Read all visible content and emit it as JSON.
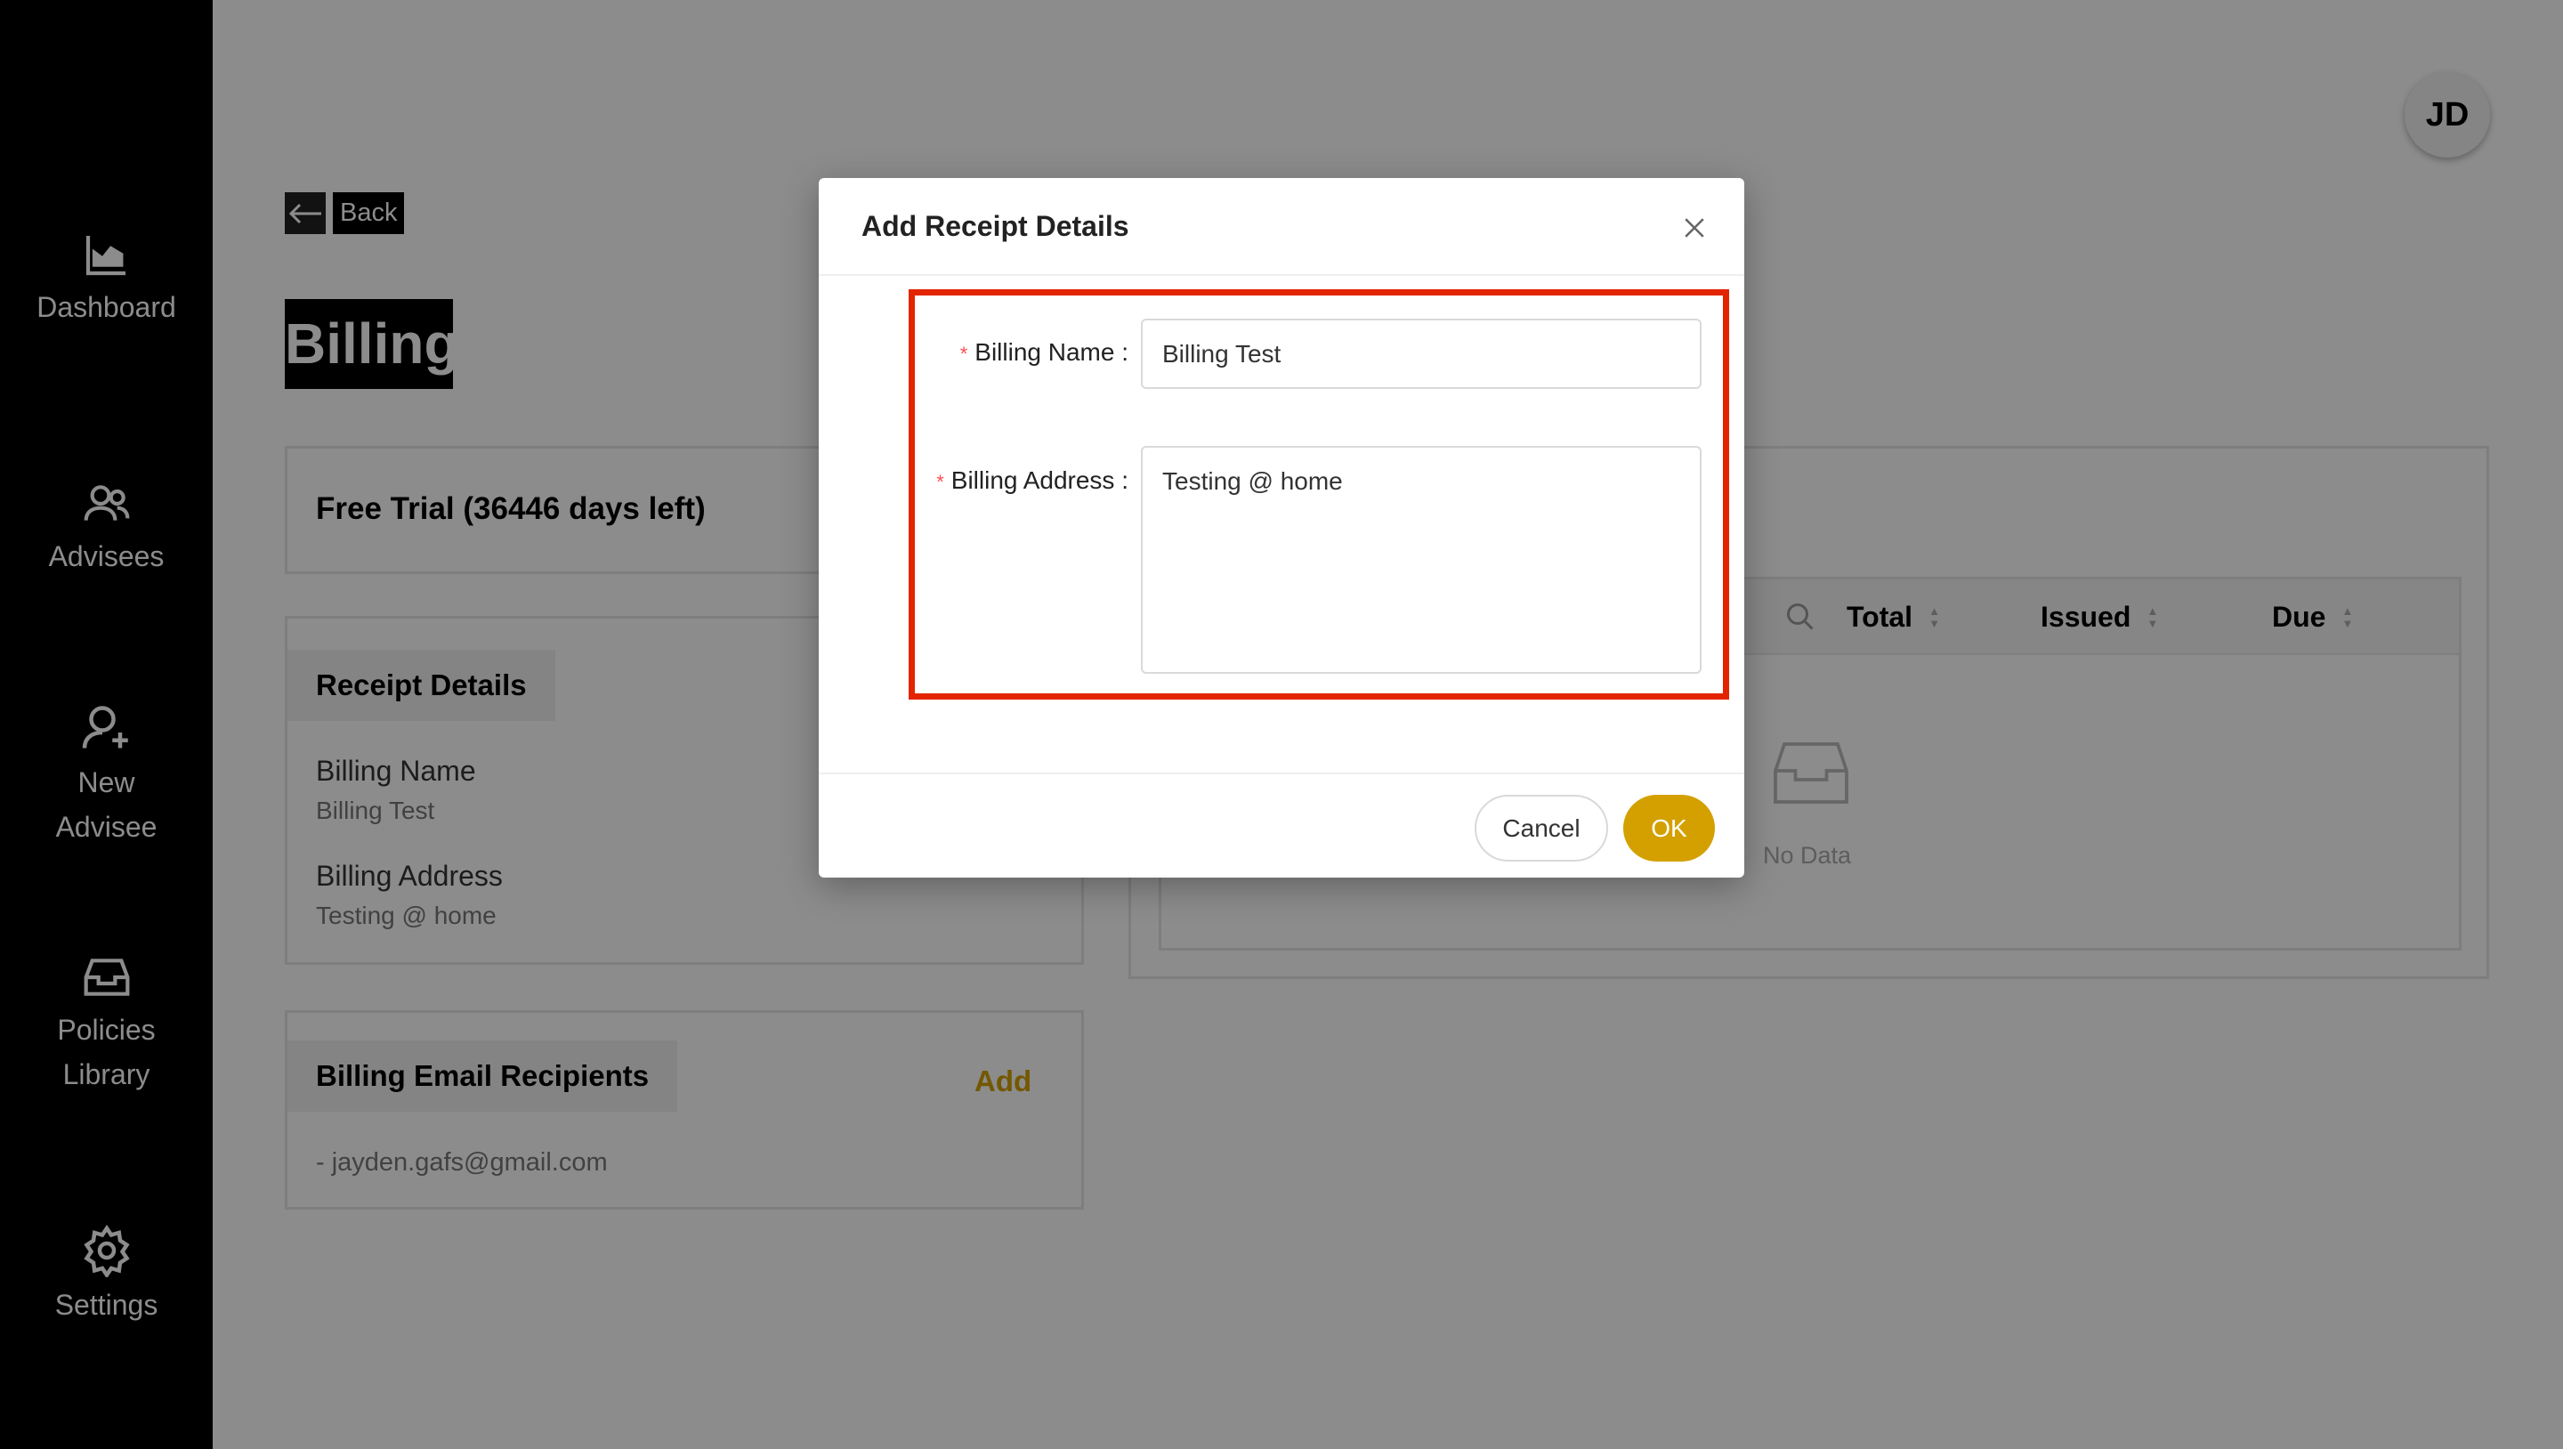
{
  "sidebar": {
    "items": [
      {
        "label": "Dashboard",
        "icon": "chart-area-icon"
      },
      {
        "label": "Advisees",
        "icon": "users-icon"
      },
      {
        "label": "New Advisee",
        "icon": "user-add-icon"
      },
      {
        "label": "Policies Library",
        "icon": "inbox-icon"
      },
      {
        "label": "Settings",
        "icon": "gear-icon"
      }
    ]
  },
  "header": {
    "avatar": "JD",
    "back": "Back",
    "title": "Billing"
  },
  "plan": {
    "status": "Free Trial (36446 days left)"
  },
  "receipt": {
    "heading": "Receipt Details",
    "name_label": "Billing Name",
    "name_value": "Billing Test",
    "address_label": "Billing Address",
    "address_value": "Testing @ home"
  },
  "emails": {
    "heading": "Billing Email Recipients",
    "add": "Add",
    "items": [
      "- jayden.gafs@gmail.com"
    ]
  },
  "table": {
    "columns": [
      "Total",
      "Issued",
      "Due"
    ],
    "empty": "No Data"
  },
  "modal": {
    "title": "Add Receipt Details",
    "name_label": "Billing Name",
    "name_value": "Billing Test",
    "address_label": "Billing Address",
    "address_value": "Testing @ home",
    "cancel": "Cancel",
    "ok": "OK"
  },
  "colors": {
    "accent": "#d4a000",
    "highlight": "#e32400",
    "sidebar": "#000000"
  }
}
